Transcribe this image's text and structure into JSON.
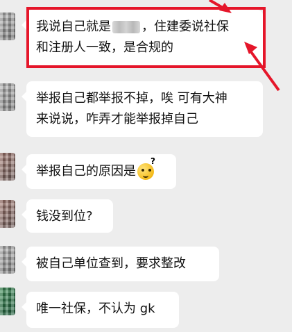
{
  "messages": [
    {
      "line1_before": "我说自己就是",
      "line1_after": "，住建委说社保",
      "line2": "和注册人一致，是合规的"
    },
    {
      "line1": "举报自己都举报不掉，唉 可有大神",
      "line2": "来说说，咋弄才能举报掉自己"
    },
    {
      "text": "举报自己的原因是",
      "emoji_icon": "thinking-face-icon"
    },
    {
      "text": "钱没到位?"
    },
    {
      "text": "被自己单位查到，要求整改"
    },
    {
      "text": "唯一社保，不认为 gk"
    }
  ],
  "colors": {
    "background": "#ededed",
    "bubble": "#ffffff",
    "highlight": "#e5162a"
  }
}
